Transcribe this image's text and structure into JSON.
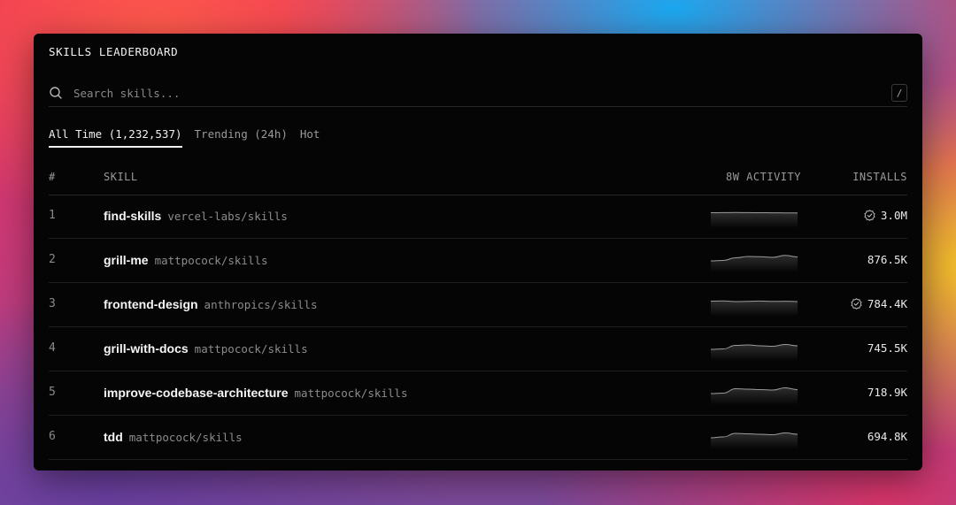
{
  "header": {
    "title": "SKILLS LEADERBOARD"
  },
  "search": {
    "placeholder": "Search skills...",
    "shortcut": "/"
  },
  "tabs": [
    {
      "label": "All Time (1,232,537)",
      "active": true
    },
    {
      "label": "Trending (24h)",
      "active": false
    },
    {
      "label": "Hot",
      "active": false
    }
  ],
  "columns": {
    "rank": "#",
    "skill": "SKILL",
    "activity": "8W ACTIVITY",
    "installs": "INSTALLS"
  },
  "rows": [
    {
      "rank": "1",
      "name": "find-skills",
      "repo": "vercel-labs/skills",
      "installs": "3.0M",
      "verified": true,
      "activity": [
        0.55,
        0.56,
        0.57,
        0.56,
        0.55,
        0.54,
        0.53,
        0.52
      ]
    },
    {
      "rank": "2",
      "name": "grill-me",
      "repo": "mattpocock/skills",
      "installs": "876.5K",
      "verified": false,
      "activity": [
        0.1,
        0.15,
        0.45,
        0.6,
        0.58,
        0.5,
        0.72,
        0.55
      ]
    },
    {
      "rank": "3",
      "name": "frontend-design",
      "repo": "anthropics/skills",
      "installs": "784.4K",
      "verified": true,
      "activity": [
        0.55,
        0.57,
        0.5,
        0.53,
        0.56,
        0.52,
        0.54,
        0.5
      ]
    },
    {
      "rank": "4",
      "name": "grill-with-docs",
      "repo": "mattpocock/skills",
      "installs": "745.5K",
      "verified": false,
      "activity": [
        0.1,
        0.15,
        0.55,
        0.6,
        0.5,
        0.45,
        0.65,
        0.5
      ]
    },
    {
      "rank": "5",
      "name": "improve-codebase-architecture",
      "repo": "mattpocock/skills",
      "installs": "718.9K",
      "verified": false,
      "activity": [
        0.1,
        0.15,
        0.65,
        0.6,
        0.55,
        0.5,
        0.75,
        0.55
      ]
    },
    {
      "rank": "6",
      "name": "tdd",
      "repo": "mattpocock/skills",
      "installs": "694.8K",
      "verified": false,
      "activity": [
        0.1,
        0.2,
        0.6,
        0.55,
        0.5,
        0.45,
        0.65,
        0.5
      ]
    }
  ],
  "icons": {
    "search": "search-icon",
    "verified": "verified-badge-icon"
  },
  "colors": {
    "panel": "#050505",
    "text": "#f5f5f5",
    "muted": "#8c8c8c",
    "divider": "#262626"
  }
}
